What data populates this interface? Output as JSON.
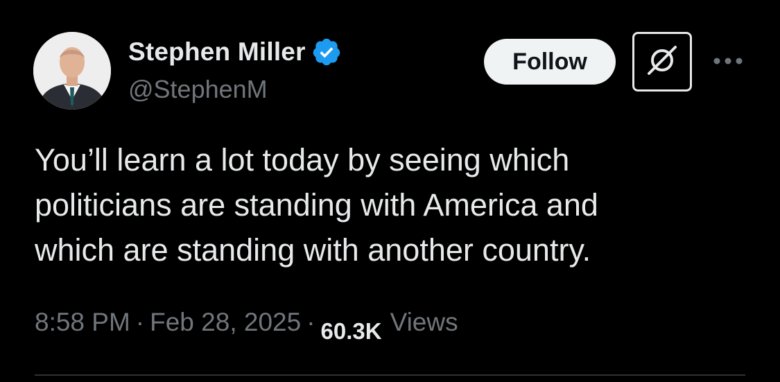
{
  "author": {
    "display_name": "Stephen Miller",
    "handle": "@StephenM",
    "verified": true
  },
  "actions": {
    "follow_label": "Follow",
    "grok_icon": "grok-icon",
    "more_icon": "more-icon"
  },
  "tweet": {
    "lines": [
      "You’ll learn a lot today by seeing which",
      "politicians are standing with America and",
      "which are standing with another country."
    ]
  },
  "meta": {
    "time": "8:58 PM",
    "separator": "·",
    "date": "Feb 28, 2025",
    "views_count": "60.3K",
    "views_label": "Views"
  },
  "colors": {
    "background": "#000000",
    "text_primary": "#e7e9ea",
    "text_secondary": "#71767b",
    "verified_blue": "#1d9bf0",
    "follow_bg": "#eff3f4"
  }
}
